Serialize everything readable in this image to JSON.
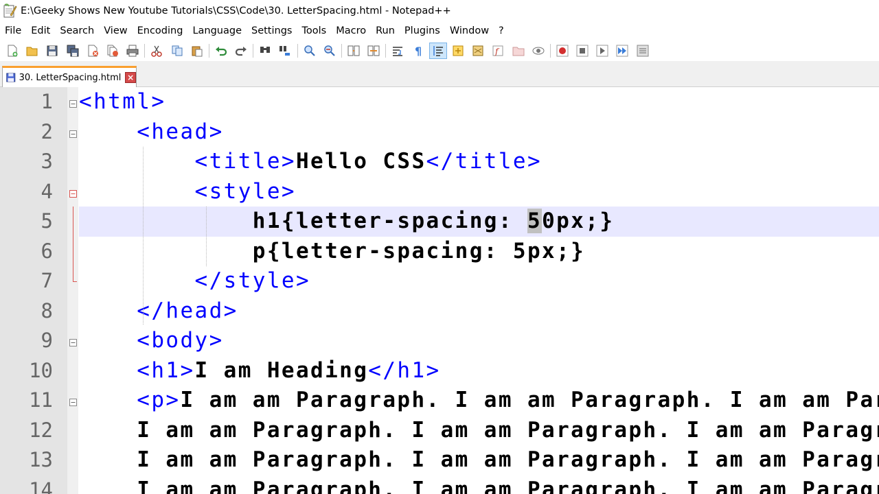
{
  "window": {
    "title": "E:\\Geeky Shows New Youtube Tutorials\\CSS\\Code\\30. LetterSpacing.html - Notepad++"
  },
  "menu": [
    "File",
    "Edit",
    "Search",
    "View",
    "Encoding",
    "Language",
    "Settings",
    "Tools",
    "Macro",
    "Run",
    "Plugins",
    "Window",
    "?"
  ],
  "toolbar": {
    "icons": [
      "new-file-icon",
      "open-file-icon",
      "save-icon",
      "save-all-icon",
      "close-icon",
      "close-all-icon",
      "print-icon",
      "cut-icon",
      "copy-icon",
      "paste-icon",
      "undo-icon",
      "redo-icon",
      "find-icon",
      "replace-icon",
      "zoom-in-icon",
      "zoom-out-icon",
      "sync-vertical-icon",
      "sync-horizontal-icon",
      "word-wrap-icon",
      "show-all-chars-icon",
      "indent-guide-icon",
      "user-lang-icon",
      "doc-map-icon",
      "function-list-icon",
      "folder-workspace-icon",
      "monitoring-icon",
      "record-macro-icon",
      "stop-macro-icon",
      "play-macro-icon",
      "run-macro-multiple-icon",
      "save-macro-icon"
    ]
  },
  "tab": {
    "label": "30. LetterSpacing.html"
  },
  "editor": {
    "lines": [
      {
        "n": "1",
        "parts": [
          [
            "tag",
            "<html>"
          ]
        ]
      },
      {
        "n": "2",
        "parts": [
          [
            "txt",
            "    "
          ],
          [
            "tag",
            "<head>"
          ]
        ]
      },
      {
        "n": "3",
        "parts": [
          [
            "txt",
            "        "
          ],
          [
            "tag",
            "<title>"
          ],
          [
            "txt",
            "Hello CSS"
          ],
          [
            "tag",
            "</title>"
          ]
        ]
      },
      {
        "n": "4",
        "parts": [
          [
            "txt",
            "        "
          ],
          [
            "tag",
            "<style>"
          ]
        ]
      },
      {
        "n": "5",
        "parts": [
          [
            "txt",
            "            h1{letter-spacing: "
          ],
          [
            "sel",
            "5"
          ],
          [
            "txt",
            "0px;}"
          ]
        ]
      },
      {
        "n": "6",
        "parts": [
          [
            "txt",
            "            p{letter-spacing: 5px;}"
          ]
        ]
      },
      {
        "n": "7",
        "parts": [
          [
            "txt",
            "        "
          ],
          [
            "tag",
            "</style>"
          ]
        ]
      },
      {
        "n": "8",
        "parts": [
          [
            "txt",
            "    "
          ],
          [
            "tag",
            "</head>"
          ]
        ]
      },
      {
        "n": "9",
        "parts": [
          [
            "txt",
            "    "
          ],
          [
            "tag",
            "<body>"
          ]
        ]
      },
      {
        "n": "10",
        "parts": [
          [
            "txt",
            "    "
          ],
          [
            "tag",
            "<h1>"
          ],
          [
            "txt",
            "I am Heading"
          ],
          [
            "tag",
            "</h1>"
          ]
        ]
      },
      {
        "n": "11",
        "parts": [
          [
            "txt",
            "    "
          ],
          [
            "tag",
            "<p>"
          ],
          [
            "txt",
            "I am am Paragraph. I am am Paragraph. I am am Paragraph."
          ]
        ]
      },
      {
        "n": "12",
        "parts": [
          [
            "txt",
            "    I am am Paragraph. I am am Paragraph. I am am Paragraph."
          ]
        ]
      },
      {
        "n": "13",
        "parts": [
          [
            "txt",
            "    I am am Paragraph. I am am Paragraph. I am am Paragraph."
          ]
        ]
      },
      {
        "n": "14",
        "parts": [
          [
            "txt",
            "    I am am Paragraph. I am am Paragraph. I am am Paragraph."
          ]
        ]
      }
    ],
    "current_line": "5"
  },
  "colors": {
    "tag": "#0000ff",
    "text": "#000000",
    "current_line_bg": "#e8e8ff",
    "gutter_bg": "#e4e4e4",
    "tab_accent": "#fa9f2e"
  }
}
